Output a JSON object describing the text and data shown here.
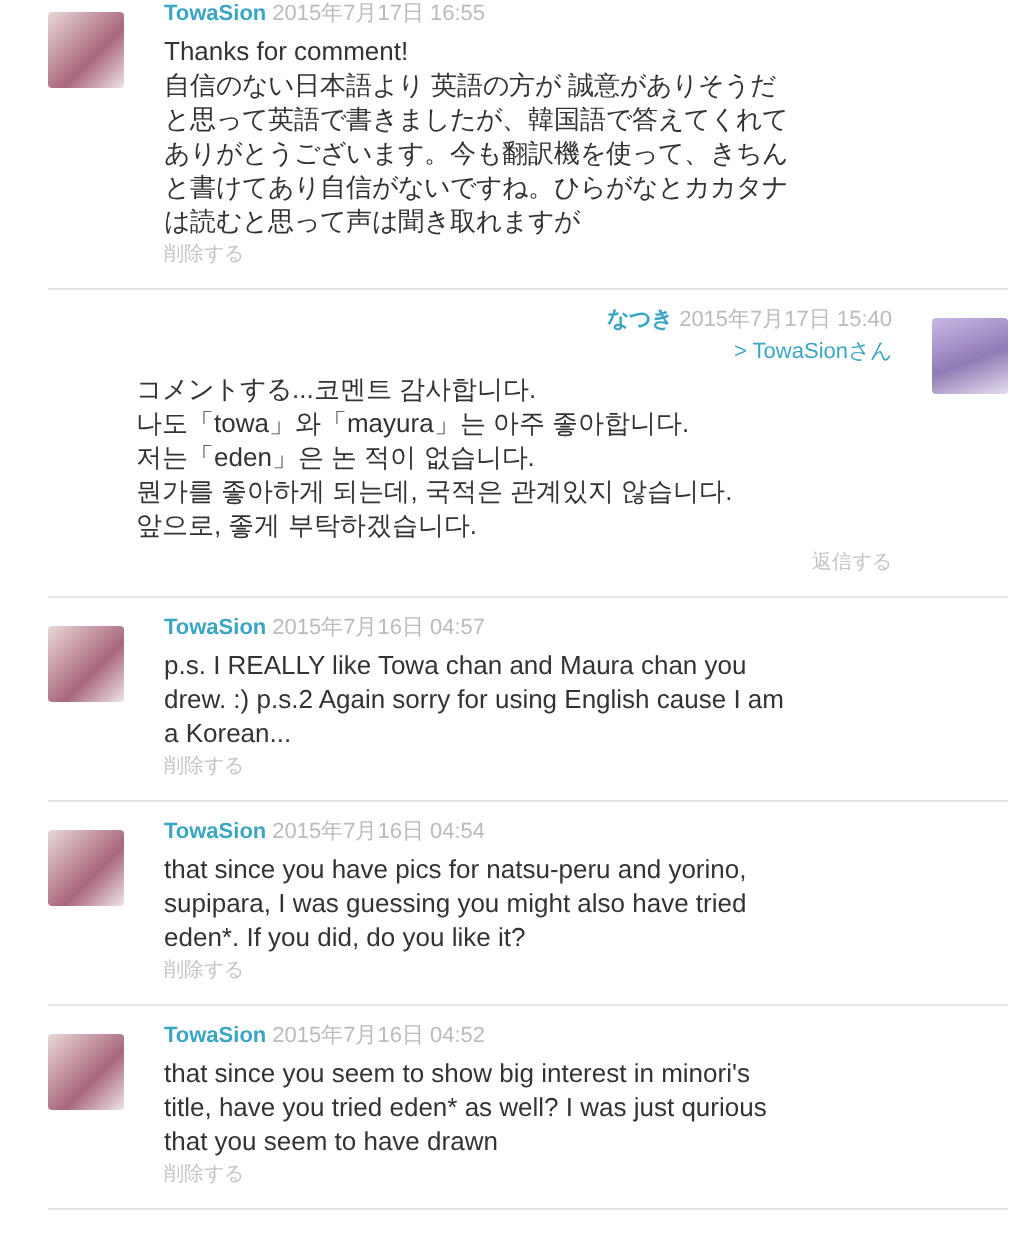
{
  "comments": [
    {
      "kind": "comment",
      "author": "TowaSion",
      "date": "2015年7月17日 16:55",
      "body": "Thanks for comment!\n自信のない日本語より 英語の方が 誠意がありそうだと思って英語で書きましたが、韓国語で答えてくれてありがとうございます。今も翻訳機を使って、きちんと書けてあり自信がないですね。ひらがなとカカタナは読むと思って声は聞き取れますが",
      "action": "削除する"
    },
    {
      "kind": "reply",
      "author": "なつき",
      "date": "2015年7月17日 15:40",
      "to": "> TowaSionさん",
      "body": "コメントする...코멘트 감사합니다.\n나도「towa」와「mayura」는 아주 좋아합니다.\n저는「eden」은 논 적이 없습니다.\n뭔가를 좋아하게 되는데, 국적은 관계있지 않습니다.\n앞으로, 좋게 부탁하겠습니다.",
      "action": "返信する"
    },
    {
      "kind": "comment",
      "author": "TowaSion",
      "date": "2015年7月16日 04:57",
      "body": "p.s. I REALLY like Towa chan and Maura chan you drew. :) p.s.2 Again sorry for using English cause I am a Korean...",
      "action": "削除する"
    },
    {
      "kind": "comment",
      "author": "TowaSion",
      "date": "2015年7月16日 04:54",
      "body": "that since you have pics for natsu-peru and yorino, supipara, I was guessing you might also have tried eden*. If you did, do you like it?",
      "action": "削除する"
    },
    {
      "kind": "comment",
      "author": "TowaSion",
      "date": "2015年7月16日 04:52",
      "body": "that since you seem to show big interest in minori's title, have you tried eden* as well? I was just qurious that you seem to have drawn",
      "action": "削除する"
    }
  ]
}
